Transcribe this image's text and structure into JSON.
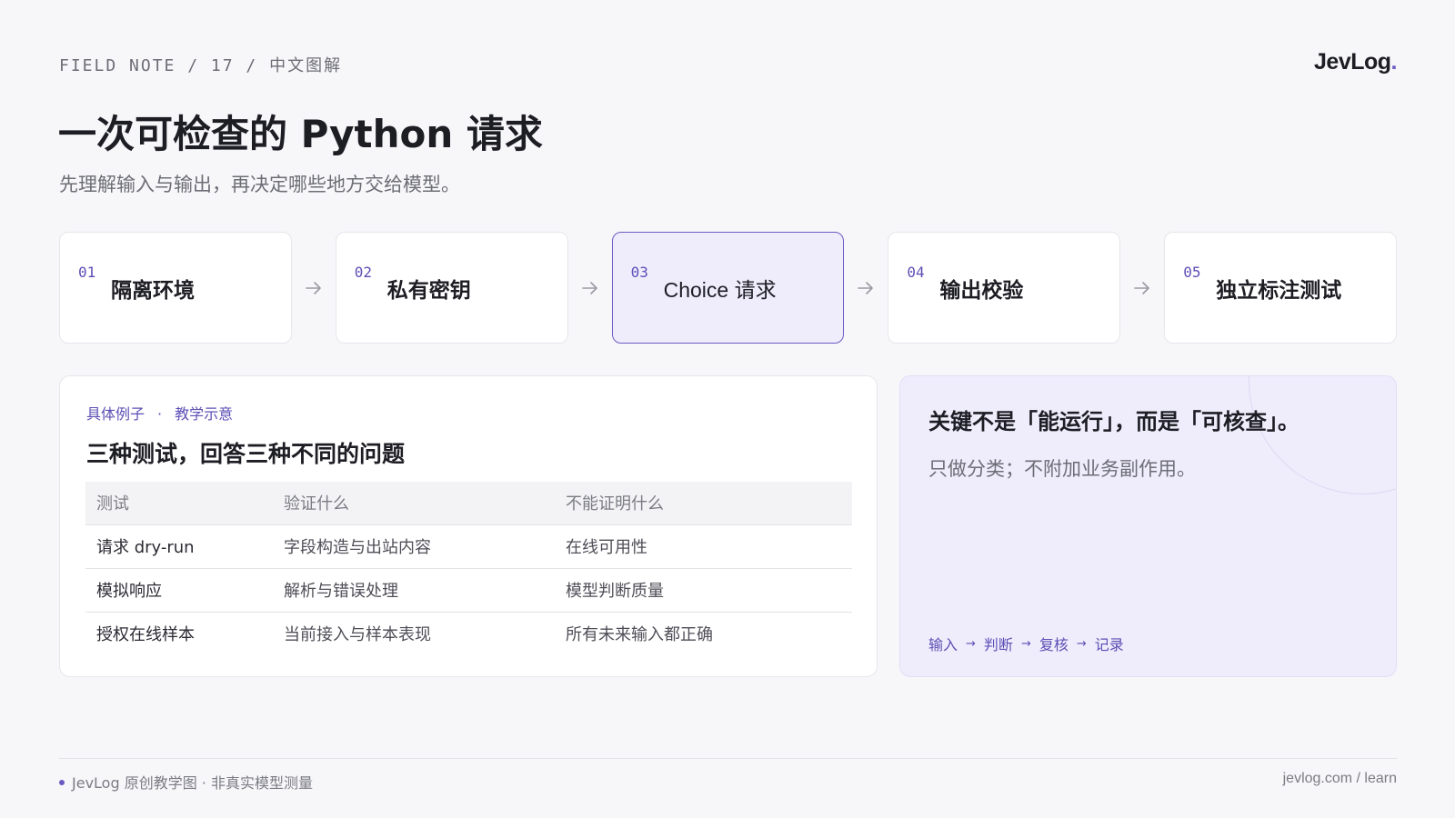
{
  "header": {
    "kicker": "FIELD NOTE / 17 / 中文图解",
    "logo": "JevLog",
    "logo_dot": ".",
    "title": "一次可检查的 Python 请求",
    "subtitle": "先理解输入与输出，再决定哪些地方交给模型。"
  },
  "steps": [
    {
      "num": "01",
      "label": "隔离环境",
      "active": false
    },
    {
      "num": "02",
      "label": "私有密钥",
      "active": false
    },
    {
      "num": "03",
      "label": "Choice 请求",
      "active": true
    },
    {
      "num": "04",
      "label": "输出校验",
      "active": false
    },
    {
      "num": "05",
      "label": "独立标注测试",
      "active": false
    }
  ],
  "card": {
    "eyebrow_a": "具体例子",
    "eyebrow_sep": "·",
    "eyebrow_b": "教学示意",
    "title": "三种测试，回答三种不同的问题",
    "columns": [
      "测试",
      "验证什么",
      "不能证明什么"
    ],
    "rows": [
      [
        "请求 dry-run",
        "字段构造与出站内容",
        "在线可用性"
      ],
      [
        "模拟响应",
        "解析与错误处理",
        "模型判断质量"
      ],
      [
        "授权在线样本",
        "当前接入与样本表现",
        "所有未来输入都正确"
      ]
    ]
  },
  "note": {
    "title": "关键不是「能运行」，而是「可核查」。",
    "subtitle": "只做分类；不附加业务副作用。",
    "flow": [
      "输入",
      "判断",
      "复核",
      "记录"
    ],
    "flow_arrow": "→"
  },
  "footer": {
    "left": "JevLog 原创教学图 · 非真实模型测量",
    "right": "jevlog.com / learn"
  },
  "colors": {
    "accent": "#6a5bc4",
    "active_bg": "#efedfc",
    "background": "#f7f7fa"
  }
}
